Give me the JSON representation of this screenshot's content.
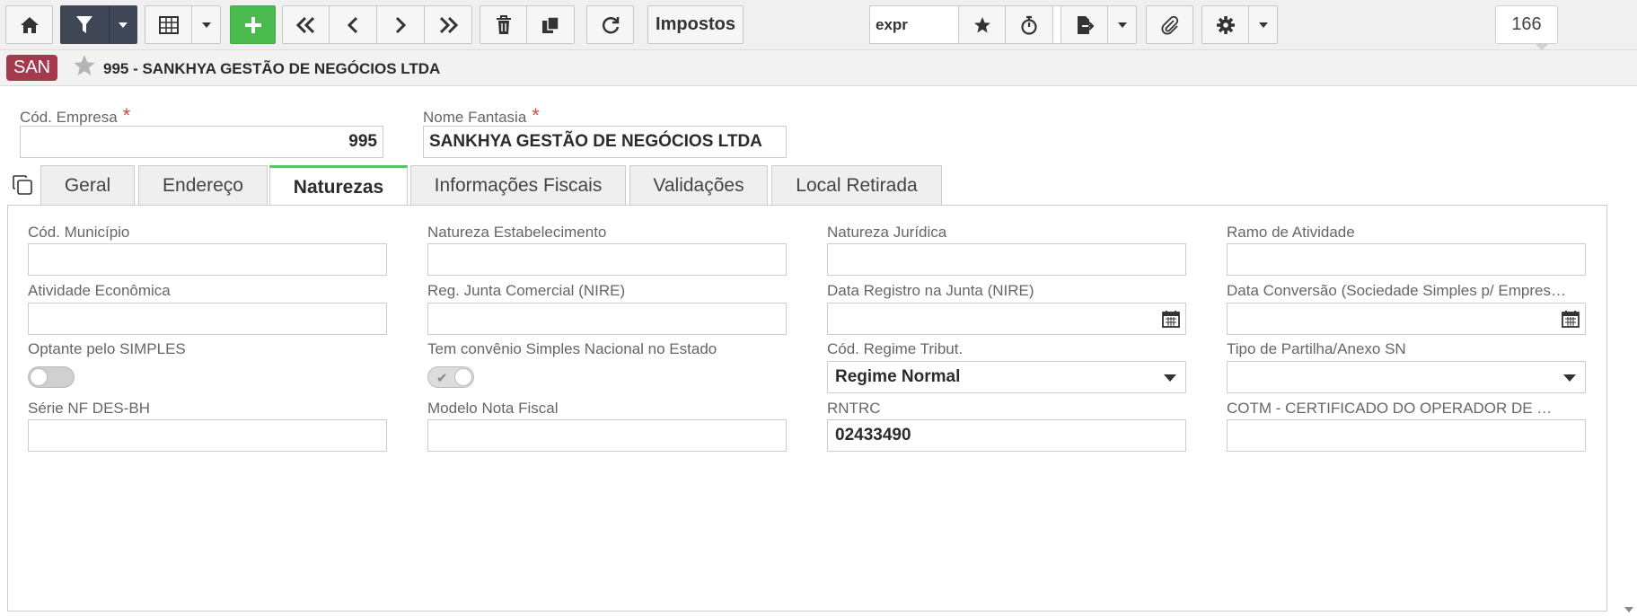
{
  "toolbar": {
    "taxes_label": "Impostos",
    "search_value": "expr",
    "record_count": "166"
  },
  "header": {
    "module_badge": "SAN",
    "title": "995 - SANKHYA GESTÃO DE NEGÓCIOS LTDA"
  },
  "form": {
    "company_code_label": "Cód. Empresa",
    "company_code_value": "995",
    "trade_name_label": "Nome Fantasia",
    "trade_name_value": "SANKHYA GESTÃO DE NEGÓCIOS LTDA",
    "required_mark": "*"
  },
  "tabs": [
    {
      "label": "Geral",
      "active": false
    },
    {
      "label": "Endereço",
      "active": false
    },
    {
      "label": "Naturezas",
      "active": true
    },
    {
      "label": "Informações Fiscais",
      "active": false
    },
    {
      "label": "Validações",
      "active": false
    },
    {
      "label": "Local Retirada",
      "active": false
    }
  ],
  "naturezas": {
    "row1": [
      {
        "label": "Cód. Município",
        "value": ""
      },
      {
        "label": "Natureza Estabelecimento",
        "value": ""
      },
      {
        "label": "Natureza Jurídica",
        "value": ""
      },
      {
        "label": "Ramo de Atividade",
        "value": ""
      }
    ],
    "row2": [
      {
        "label": "Atividade Econômica",
        "value": ""
      },
      {
        "label": "Reg. Junta Comercial (NIRE)",
        "value": ""
      },
      {
        "label": "Data Registro na Junta (NIRE)",
        "value": ""
      },
      {
        "label": "Data Conversão (Sociedade Simples p/ Empresária)",
        "value": ""
      }
    ],
    "row3": [
      {
        "label": "Optante pelo SIMPLES",
        "value": false
      },
      {
        "label": "Tem convênio Simples Nacional no Estado",
        "value": true
      },
      {
        "label": "Cód. Regime Tribut.",
        "value": "Regime Normal"
      },
      {
        "label": "Tipo de Partilha/Anexo SN",
        "value": ""
      }
    ],
    "row4": [
      {
        "label": "Série NF DES-BH",
        "value": ""
      },
      {
        "label": "Modelo Nota Fiscal",
        "value": ""
      },
      {
        "label": "RNTRC",
        "value": "02433490"
      },
      {
        "label": "COTM - CERTIFICADO DO OPERADOR DE TRANSPORTE MULTIMODAL",
        "value": ""
      }
    ]
  },
  "icons": {
    "home": "home-icon",
    "filter": "filter-icon",
    "grid": "grid-icon",
    "add": "plus-icon",
    "first": "double-chevron-left-icon",
    "prev": "chevron-left-icon",
    "next": "chevron-right-icon",
    "last": "double-chevron-right-icon",
    "delete": "trash-icon",
    "duplicate": "copy-icon",
    "refresh": "refresh-icon",
    "search": "search-icon",
    "favorite": "star-icon",
    "timer": "stopwatch-icon",
    "export": "export-icon",
    "attach": "paperclip-icon",
    "settings": "gear-icon",
    "calendar": "calendar-icon"
  },
  "colors": {
    "accent_green": "#4cbb4f",
    "badge_red": "#a33a4d",
    "dark_button": "#3f4756",
    "required": "#d24a3c"
  }
}
